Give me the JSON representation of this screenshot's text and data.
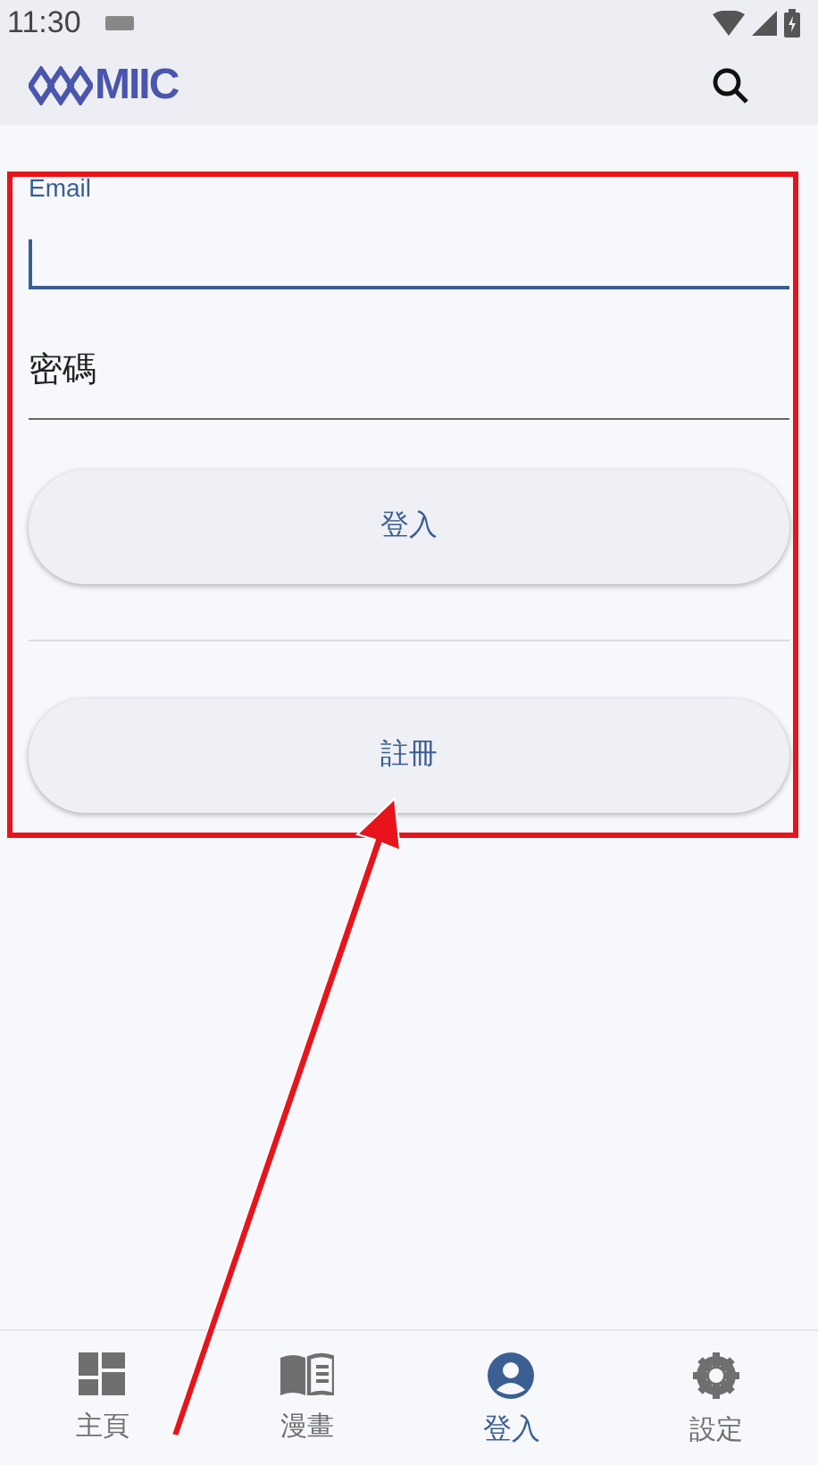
{
  "status_bar": {
    "time": "11:30"
  },
  "app_bar": {
    "logo_text": "MIIC"
  },
  "login_form": {
    "email_field": {
      "label": "Email",
      "focused": true
    },
    "password_field": {
      "placeholder": "密碼"
    },
    "login_button": "登入",
    "register_button": "註冊"
  },
  "annotation": {
    "kind": "box-with-arrow"
  },
  "bottom_nav": [
    {
      "label": "主頁",
      "kind": "dashboard",
      "selected": false
    },
    {
      "label": "漫畫",
      "kind": "book",
      "selected": false
    },
    {
      "label": "登入",
      "kind": "account",
      "selected": true
    },
    {
      "label": "設定",
      "kind": "settings",
      "selected": false
    }
  ]
}
